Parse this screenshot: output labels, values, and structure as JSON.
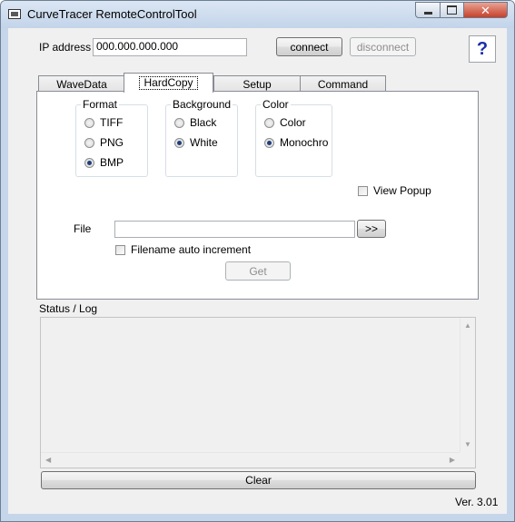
{
  "window": {
    "title": "CurveTracer RemoteControlTool",
    "icons": {
      "app": "terminal-icon",
      "minimize": "minimize-icon",
      "maximize": "maximize-icon",
      "close": "close-icon"
    },
    "close_glyph": "✕"
  },
  "connection": {
    "ip_label": "IP address",
    "ip_value": "000.000.000.000",
    "connect_label": "connect",
    "disconnect_label": "disconnect",
    "help_label": "?"
  },
  "tabs": [
    {
      "label": "WaveData",
      "active": false
    },
    {
      "label": "HardCopy",
      "active": true
    },
    {
      "label": "Setup",
      "active": false
    },
    {
      "label": "Command",
      "active": false
    }
  ],
  "hardcopy": {
    "format": {
      "title": "Format",
      "options": [
        {
          "label": "TIFF",
          "selected": false
        },
        {
          "label": "PNG",
          "selected": false
        },
        {
          "label": "BMP",
          "selected": true
        }
      ]
    },
    "background": {
      "title": "Background",
      "options": [
        {
          "label": "Black",
          "selected": false
        },
        {
          "label": "White",
          "selected": true
        }
      ]
    },
    "color": {
      "title": "Color",
      "options": [
        {
          "label": "Color",
          "selected": false
        },
        {
          "label": "Monochro",
          "selected": true
        }
      ]
    },
    "view_popup_label": "View Popup",
    "view_popup_checked": false,
    "file_label": "File",
    "file_value": "",
    "browse_label": ">>",
    "auto_increment_label": "Filename auto increment",
    "auto_increment_checked": false,
    "get_label": "Get"
  },
  "status": {
    "label": "Status / Log",
    "log_text": "",
    "scroll_up": "▲",
    "scroll_down": "▼",
    "scroll_left": "◀",
    "scroll_right": "▶"
  },
  "clear_label": "Clear",
  "version": "Ver. 3.01",
  "colors": {
    "titlebar": "#c6d6ea",
    "close_button": "#c7402a",
    "help_glyph": "#1a2fa8",
    "client_bg": "#f0f0f0"
  }
}
